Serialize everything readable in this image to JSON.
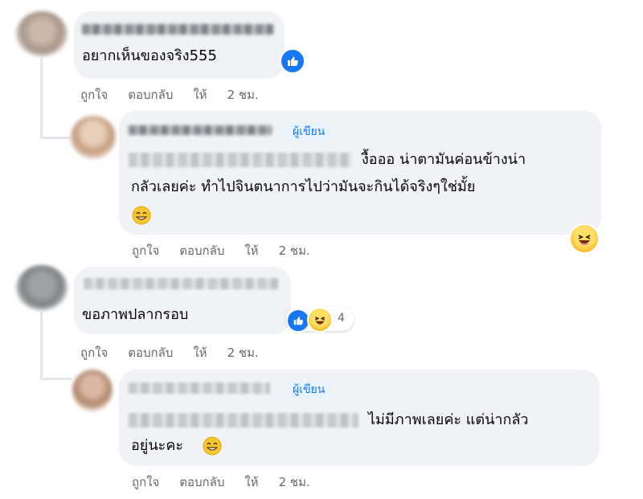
{
  "comments": [
    {
      "text_lines": [
        "อยากเห็นของจริง555"
      ],
      "reaction_count": "",
      "actions": {
        "like": "ถูกใจ",
        "reply": "ตอบกลับ",
        "share": "ให้",
        "time": "2 ชม."
      }
    },
    {
      "author_badge": "ผู้เขียน",
      "text_lines": [
        "งื้อออ น่าตามันค่อนข้างน่า",
        "กลัวเลยค่ะ ทำไปจินตนาการไปว่ามันจะกินได้จริงๆใช่มั้ย"
      ],
      "actions": {
        "like": "ถูกใจ",
        "reply": "ตอบกลับ",
        "share": "ให้",
        "time": "2 ชม."
      }
    },
    {
      "text_lines": [
        "ขอภาพปลากรอบ"
      ],
      "reaction_count": "4",
      "actions": {
        "like": "ถูกใจ",
        "reply": "ตอบกลับ",
        "share": "ให้",
        "time": "2 ชม."
      }
    },
    {
      "author_badge": "ผู้เขียน",
      "text_lines": [
        "ไม่มีภาพเลยค่ะ แต่น่ากลัว",
        "อยู่นะคะ"
      ],
      "actions": {
        "like": "ถูกใจ",
        "reply": "ตอบกลับ",
        "share": "ให้",
        "time": "2 ชม."
      }
    }
  ],
  "icons": {
    "like": "thumbs-up-icon",
    "haha": "laughing-face-icon",
    "smile": "smiling-face-icon"
  },
  "colors": {
    "bubble": "#f0f2f5",
    "meta": "#65676b",
    "author_badge": "#1877f2",
    "like_blue": "#1877f2",
    "haha_yellow": "#f7b928"
  }
}
